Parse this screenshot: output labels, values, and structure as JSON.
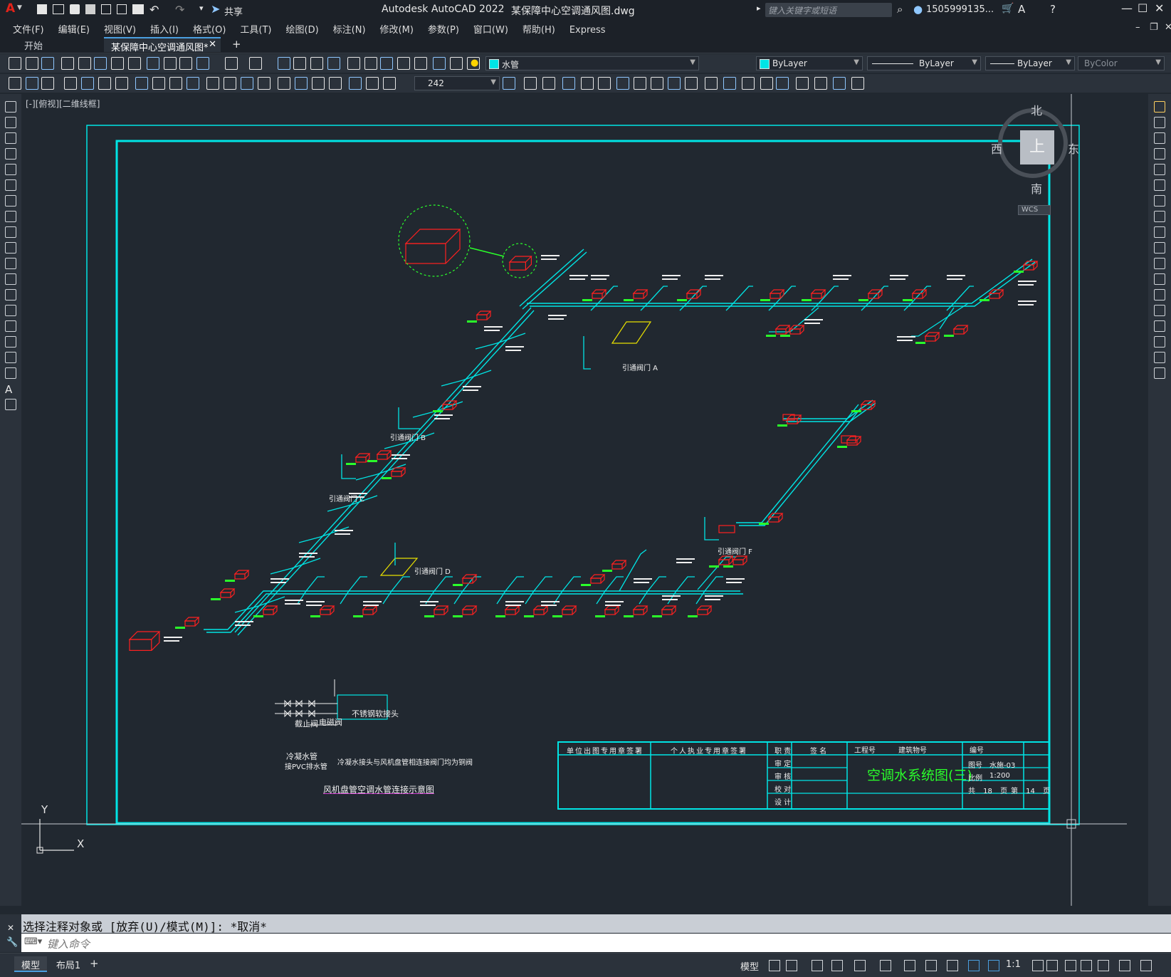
{
  "app": {
    "title": "Autodesk AutoCAD 2022",
    "filename": "某保障中心空调通风图.dwg",
    "share_label": "共享",
    "search_placeholder": "键入关键字或短语",
    "user": "1505999135...",
    "logo": "A"
  },
  "menu": [
    "文件(F)",
    "编辑(E)",
    "视图(V)",
    "插入(I)",
    "格式(O)",
    "工具(T)",
    "绘图(D)",
    "标注(N)",
    "修改(M)",
    "参数(P)",
    "窗口(W)",
    "帮助(H)",
    "Express"
  ],
  "tabs": {
    "start": "开始",
    "active": "某保障中心空调通风图*",
    "add": "+"
  },
  "toolbar": {
    "layer_name": "水管",
    "color": "ByLayer",
    "linetype": "ByLayer",
    "lineweight": "ByLayer",
    "plotstyle": "ByColor",
    "dimstyle_value": "242"
  },
  "viewport": {
    "label": "[-][俯视][二维线框]",
    "viewcube": {
      "north": "北",
      "south": "南",
      "east": "东",
      "west": "西",
      "top": "上",
      "wcs": "WCS"
    },
    "ucs": {
      "x": "X",
      "y": "Y"
    }
  },
  "drawing": {
    "valve_labels": [
      "引通阀门 A",
      "引通阀门 B",
      "引通阀门 C",
      "引通阀门 D",
      "引通阀门 F"
    ],
    "detail": {
      "title": "风机盘管空调水管连接示意图",
      "labels": [
        "不锈钢软接头",
        "截止阀",
        "电磁阀",
        "冷凝水管",
        "接PVC排水管",
        "冷凝水接头与风机盘管相连接阀门均为铜阀"
      ]
    },
    "titleblock": {
      "unit_seal": "单位出图专用章签署",
      "personal_seal": "个人执业专用章签署",
      "role_header": "职 责",
      "sign_header": "签 名",
      "project_no": "工程号",
      "building_no": "建筑物号",
      "number": "编号",
      "roles": [
        "审 定",
        "审 核",
        "校 对",
        "设 计"
      ],
      "drawing_title": "空调水系统图(三)",
      "fig_no_label": "图号",
      "fig_no": "水施-03",
      "scale_label": "比例",
      "scale": "1:200",
      "total": "共 18 页",
      "page": "第 14 页"
    }
  },
  "command": {
    "history": "选择注释对象或 [放弃(U)/模式(M)]: *取消*",
    "placeholder": "键入命令"
  },
  "status": {
    "layout_tabs": [
      "模型",
      "布局1"
    ],
    "model_label": "模型",
    "scale": "1:1"
  },
  "colors": {
    "cyan": "#00e5e5",
    "red": "#ff2020",
    "green": "#2aff2a",
    "yellow": "#e8e000",
    "white": "#f0f0f0"
  }
}
